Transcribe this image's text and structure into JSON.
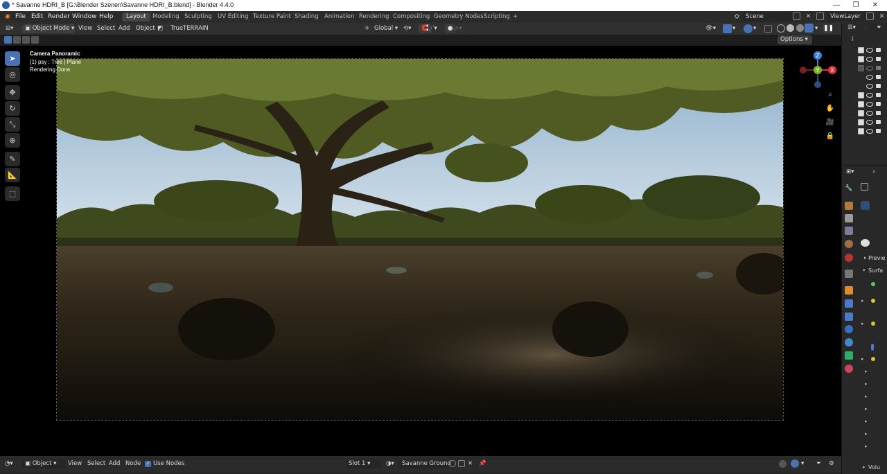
{
  "window": {
    "title": "* Savanne HDRI_B [G:\\Blender Szenen\\Savanne HDRI_B.blend] - Blender 4.4.0",
    "controls": [
      "—",
      "❐",
      "✕"
    ]
  },
  "menubar": {
    "menus": [
      "File",
      "Edit",
      "Render",
      "Window",
      "Help"
    ],
    "workspaces": [
      "Layout",
      "Modeling",
      "Sculpting",
      "UV Editing",
      "Texture Paint",
      "Shading",
      "Animation",
      "Rendering",
      "Compositing",
      "Geometry Nodes",
      "Scripting"
    ],
    "active_workspace": "Layout",
    "add_tab": "+",
    "scene": "Scene",
    "view_layer": "ViewLayer"
  },
  "header3d": {
    "mode": "Object Mode",
    "menus": [
      "View",
      "Select",
      "Add",
      "Object"
    ],
    "addon_label": "TrueTERRAIN",
    "transform_orientation": "Global",
    "options": "Options"
  },
  "viewport": {
    "overlay_lines": [
      "Camera Panoramic",
      "(1) psy : Tree | Plane",
      "Rendering Done"
    ],
    "gizmo": {
      "z": "Z",
      "y": "Y",
      "x": "X"
    },
    "colors": {
      "sky": "#b9cde0",
      "foliage": "#5e6a2a",
      "ground": "#2a2216",
      "x_axis": "#e3343b",
      "y_axis": "#7fb41c",
      "z_axis": "#3b7fd8"
    }
  },
  "bottombar": {
    "editor": "Object",
    "menus": [
      "View",
      "Select",
      "Add",
      "Node"
    ],
    "use_nodes": "Use Nodes",
    "slot": "Slot 1",
    "material": "Savanne Ground"
  },
  "properties": {
    "panels": [
      "Previe",
      "Surfa",
      "Volu"
    ]
  }
}
